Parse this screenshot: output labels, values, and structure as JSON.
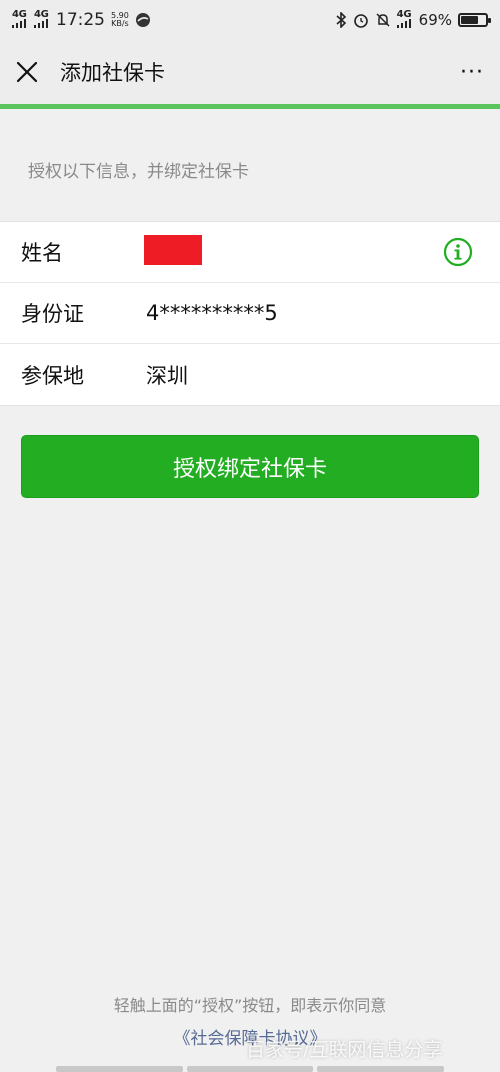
{
  "status_bar": {
    "network_1": "4G",
    "network_2": "4G",
    "time": "17:25",
    "speed_value": "5.90",
    "speed_unit": "KB/s",
    "network_3": "4G",
    "battery_percent": "69%",
    "battery_level": 0.69
  },
  "nav": {
    "title": "添加社保卡",
    "more_label": "···"
  },
  "progress_fraction": 1.0,
  "hint": "授权以下信息，并绑定社保卡",
  "info_rows": [
    {
      "label": "姓名",
      "value": ""
    },
    {
      "label": "身份证",
      "value": "4**********5"
    },
    {
      "label": "参保地",
      "value": "深圳"
    }
  ],
  "primary_button": "授权绑定社保卡",
  "footer": {
    "notice": "轻触上面的“授权”按钮，即表示你同意",
    "agreement": "《社会保障卡协议》"
  },
  "watermark": "百家号/互联网信息分享",
  "colors": {
    "accent_green": "#22ad22",
    "redaction": "#ee1c25",
    "link": "#576b95"
  }
}
